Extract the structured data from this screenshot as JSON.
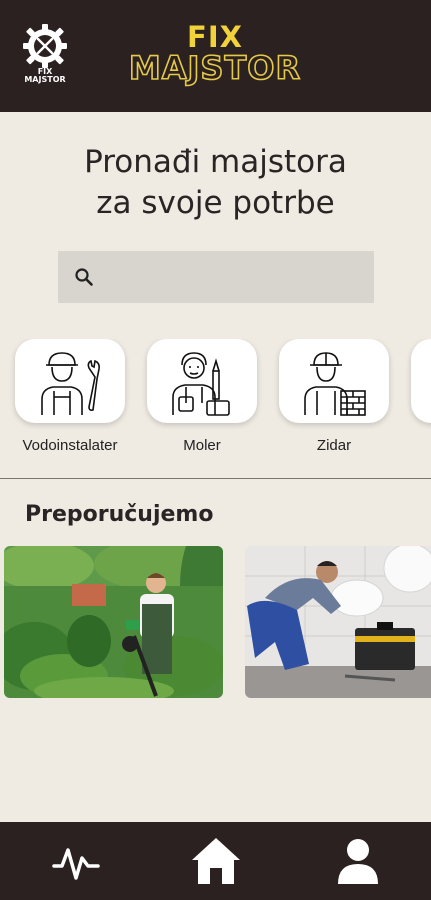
{
  "header": {
    "logo_badge_text": [
      "FIX",
      "MAJSTOR"
    ],
    "brand_line1": "FIX",
    "brand_line2": "MAJSTOR"
  },
  "hero": {
    "line1": "Pronađi majstora",
    "line2": "za svoje potrbe"
  },
  "search": {
    "placeholder": "",
    "value": ""
  },
  "categories": [
    {
      "label": "Vodoinstalater",
      "icon": "plumber-icon"
    },
    {
      "label": "Moler",
      "icon": "painter-icon"
    },
    {
      "label": "Zidar",
      "icon": "mason-icon"
    }
  ],
  "recommended": {
    "title": "Preporučujemo",
    "items": [
      {
        "image": "gardener-photo"
      },
      {
        "image": "plumber-photo"
      }
    ]
  },
  "bottom_nav": [
    {
      "icon": "activity-icon"
    },
    {
      "icon": "home-icon"
    },
    {
      "icon": "profile-icon"
    }
  ],
  "colors": {
    "header_bg": "#2c2121",
    "page_bg": "#efebe3",
    "accent_yellow": "#f1d23b",
    "search_bg": "#d8d5cf"
  }
}
